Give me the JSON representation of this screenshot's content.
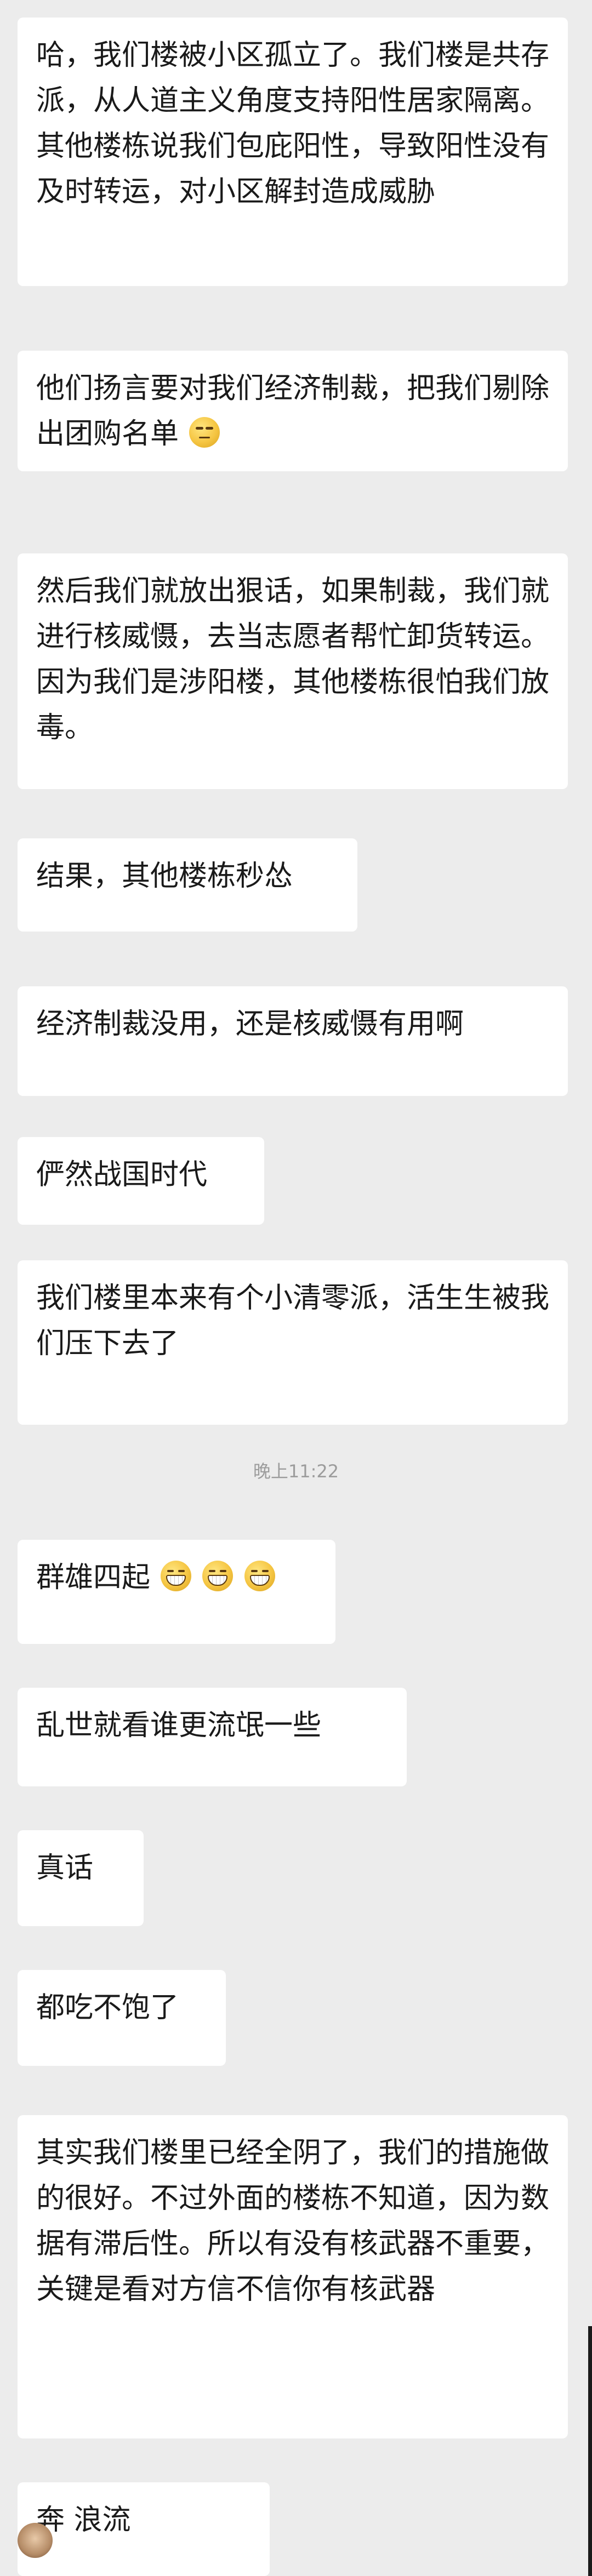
{
  "messages": [
    {
      "id": "m1",
      "sender": "",
      "text": "哈，我们楼被小区孤立了。我们楼是共存派，从人道主义角度支持阳性居家隔离。其他楼栋说我们包庇阳性，导致阳性没有及时转运，对小区解封造成威胁"
    },
    {
      "id": "m2",
      "sender": "",
      "text": "他们扬言要对我们经济制裁，把我们剔除出团购名单",
      "emoji": "unamused-face-icon"
    },
    {
      "id": "m3",
      "sender": "",
      "text": "然后我们就放出狠话，如果制裁，我们就进行核威慑，去当志愿者帮忙卸货转运。因为我们是涉阳楼，其他楼栋很怕我们放毒。"
    },
    {
      "id": "m4",
      "sender": "",
      "text": "结果，其他楼栋秒怂"
    },
    {
      "id": "m5",
      "sender": "",
      "text": "经济制裁没用，还是核威慑有用啊"
    },
    {
      "id": "m6",
      "sender": "",
      "text": "俨然战国时代"
    },
    {
      "id": "m7",
      "sender": "",
      "text": "我们楼里本来有个小清零派，活生生被我们压下去了"
    },
    {
      "id": "m8",
      "sender": "",
      "text": "群雄四起",
      "emoji": "grinning-face-icon"
    },
    {
      "id": "m9",
      "sender": "",
      "text": "乱世就看谁更流氓一些"
    },
    {
      "id": "m10",
      "sender": "",
      "text": "真话"
    },
    {
      "id": "m11",
      "sender": "",
      "text": "都吃不饱了"
    },
    {
      "id": "m12",
      "sender": "",
      "text": "其实我们楼里已经全阴了，我们的措施做的很好。不过外面的楼栋不知道，因为数据有滞后性。所以有没有核武器不重要，关键是看对方信不信你有核武器"
    },
    {
      "id": "m13",
      "sender": "",
      "text": "奔 浪流"
    }
  ],
  "timestamp": "晚上11:22",
  "colors": {
    "background": "#ececec",
    "bubble": "#ffffff",
    "text": "#1a1a1a",
    "timestamp": "#9c9c9c"
  }
}
